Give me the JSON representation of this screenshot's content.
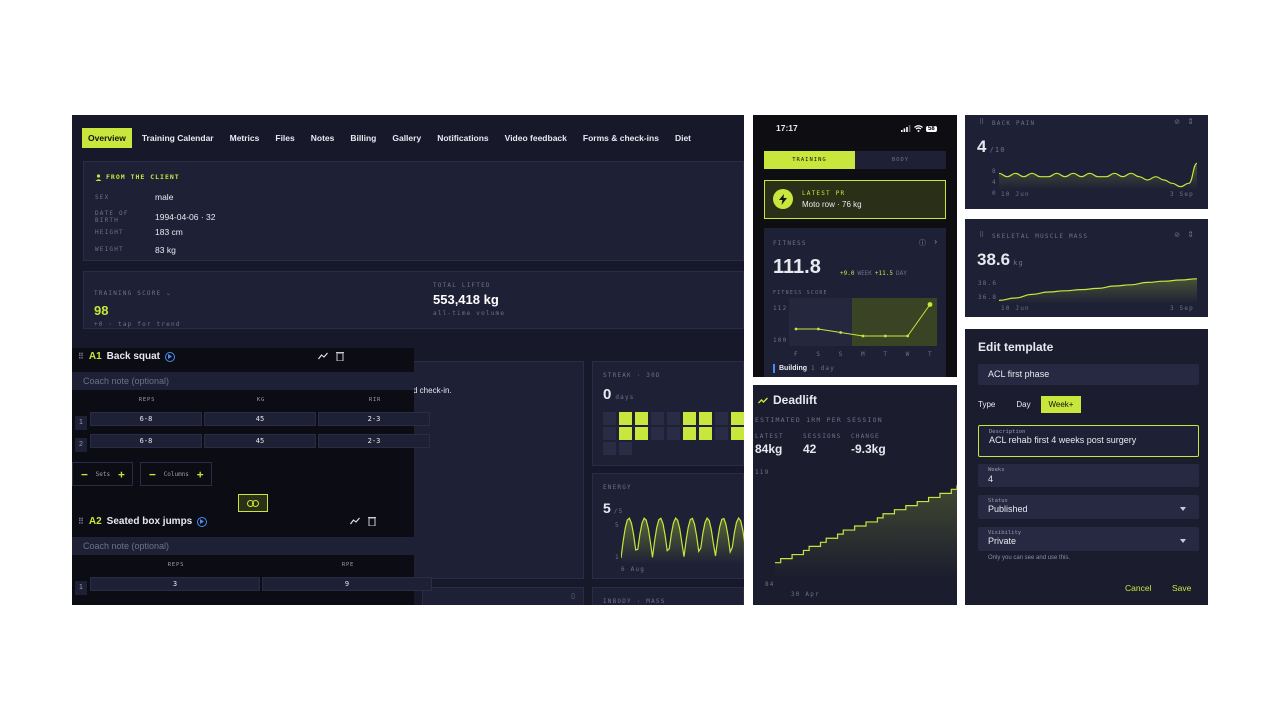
{
  "dashboard": {
    "tabs": [
      "Overview",
      "Training Calendar",
      "Metrics",
      "Files",
      "Notes",
      "Billing",
      "Gallery",
      "Notifications",
      "Video feedback",
      "Forms & check-ins",
      "Diet"
    ],
    "client": {
      "heading": "FROM THE CLIENT",
      "fields": [
        {
          "label": "SEX",
          "value": "male"
        },
        {
          "label": "DATE OF BIRTH",
          "value": "1994-04-06 · 32"
        },
        {
          "label": "HEIGHT",
          "value": "183 cm"
        },
        {
          "label": "WEIGHT",
          "value": "83 kg"
        }
      ]
    },
    "training_score": {
      "label": "TRAINING SCORE",
      "value": "98",
      "sub": "+0 · tap for trend"
    },
    "total_lifted": {
      "label": "TOTAL LIFTED",
      "value": "553,418 kg",
      "sub": "all-time volume"
    },
    "checkin_fragment": "d check-in.",
    "streak": {
      "label": "STREAK · 30D",
      "value": "0",
      "unit": "days"
    },
    "energy": {
      "label": "ENERGY",
      "value": "5",
      "unit": "/5",
      "y_top": "5",
      "y_bottom": "1",
      "x_label": "6 Aug"
    },
    "bottom_fragment": "INBODY · MASS"
  },
  "workout": {
    "exercises": [
      {
        "code": "A1",
        "name": "Back squat",
        "coach_placeholder": "Coach note (optional)",
        "columns": [
          "REPS",
          "KG",
          "RIR"
        ],
        "rows": [
          [
            "6-8",
            "45",
            "2-3"
          ],
          [
            "6-8",
            "45",
            "2-3"
          ]
        ]
      },
      {
        "code": "A2",
        "name": "Seated box jumps",
        "coach_placeholder": "Coach note (optional)",
        "columns": [
          "REPS",
          "RPE"
        ],
        "rows": [
          [
            "3",
            "9"
          ]
        ]
      }
    ],
    "sets_label": "Sets",
    "columns_label": "Columns"
  },
  "phone": {
    "time": "17:17",
    "battery": "58",
    "seg_training": "TRAINING",
    "seg_body": "BODY",
    "pr_label": "LATEST PR",
    "pr_value": "Moto row · 76 kg",
    "fitness_label": "FITNESS",
    "fitness_value": "111.8",
    "delta_week": "+9.0",
    "delta_week_label": "WEEK",
    "delta_day": "+11.5",
    "delta_day_label": "DAY",
    "score_label": "FITNESS SCORE",
    "y_top": "112",
    "y_bottom": "100",
    "days": [
      "F",
      "S",
      "S",
      "M",
      "T",
      "W",
      "T"
    ],
    "building": "Building",
    "building_sub": "1 day",
    "chart_data": {
      "type": "line",
      "x": [
        "F",
        "S",
        "S",
        "M",
        "T",
        "W",
        "T"
      ],
      "y": [
        104,
        104,
        103,
        102,
        102,
        102,
        111
      ],
      "ylim": [
        100,
        112
      ]
    }
  },
  "deadlift": {
    "title": "Deadlift",
    "subtitle": "ESTIMATED 1RM PER SESSION",
    "latest_label": "LATEST",
    "latest_value": "84kg",
    "sessions_label": "SESSIONS",
    "sessions_value": "42",
    "change_label": "CHANGE",
    "change_value": "-9.3kg",
    "y_top": "119",
    "y_bottom": "84",
    "x_label": "30 Apr",
    "chart_data": {
      "type": "area",
      "y": [
        84,
        85,
        85,
        86,
        86,
        87,
        88,
        88,
        89,
        90,
        90,
        91,
        92,
        92,
        93,
        93,
        94,
        94,
        95,
        96,
        96,
        97,
        97,
        98,
        98,
        99,
        99,
        100,
        100,
        101,
        101,
        102,
        103
      ]
    }
  },
  "back_pain": {
    "title": "BACK PAIN",
    "value": "4",
    "unit": "/10",
    "y_labels": [
      "8",
      "4",
      "0"
    ],
    "x_start": "10 Jun",
    "x_end": "3 Sep",
    "chart_data": {
      "type": "line",
      "y": [
        5,
        4,
        5,
        4,
        5,
        4,
        4,
        5,
        4,
        5,
        4,
        5,
        4,
        4,
        5,
        4,
        5,
        4,
        3,
        4,
        3,
        2,
        1,
        2,
        8
      ],
      "ylim": [
        0,
        10
      ]
    }
  },
  "muscle": {
    "title": "SKELETAL MUSCLE MASS",
    "value": "38.6",
    "unit": "kg",
    "y_labels": [
      "38.6",
      "36.8"
    ],
    "x_start": "10 Jun",
    "x_end": "3 Sep",
    "chart_data": {
      "type": "area",
      "y": [
        36.8,
        37.0,
        37.3,
        37.5,
        37.6,
        37.7,
        37.8,
        38.0,
        38.1,
        38.3,
        38.4,
        38.5,
        38.6
      ],
      "ylim": [
        36.5,
        39
      ]
    }
  },
  "template": {
    "title": "Edit template",
    "name_value": "ACL first phase",
    "type_label": "Type",
    "type_day": "Day",
    "type_week": "Week+",
    "desc_label": "Description",
    "desc_value": "ACL rehab first 4 weeks post surgery",
    "weeks_label": "Weeks",
    "weeks_value": "4",
    "status_label": "Status",
    "status_value": "Published",
    "visibility_label": "Visibility",
    "visibility_value": "Private",
    "visibility_help": "Only you can see and use this.",
    "cancel": "Cancel",
    "save": "Save"
  },
  "colors": {
    "accent": "#c8e63c",
    "bg": "#171829",
    "card": "#1e2035"
  }
}
